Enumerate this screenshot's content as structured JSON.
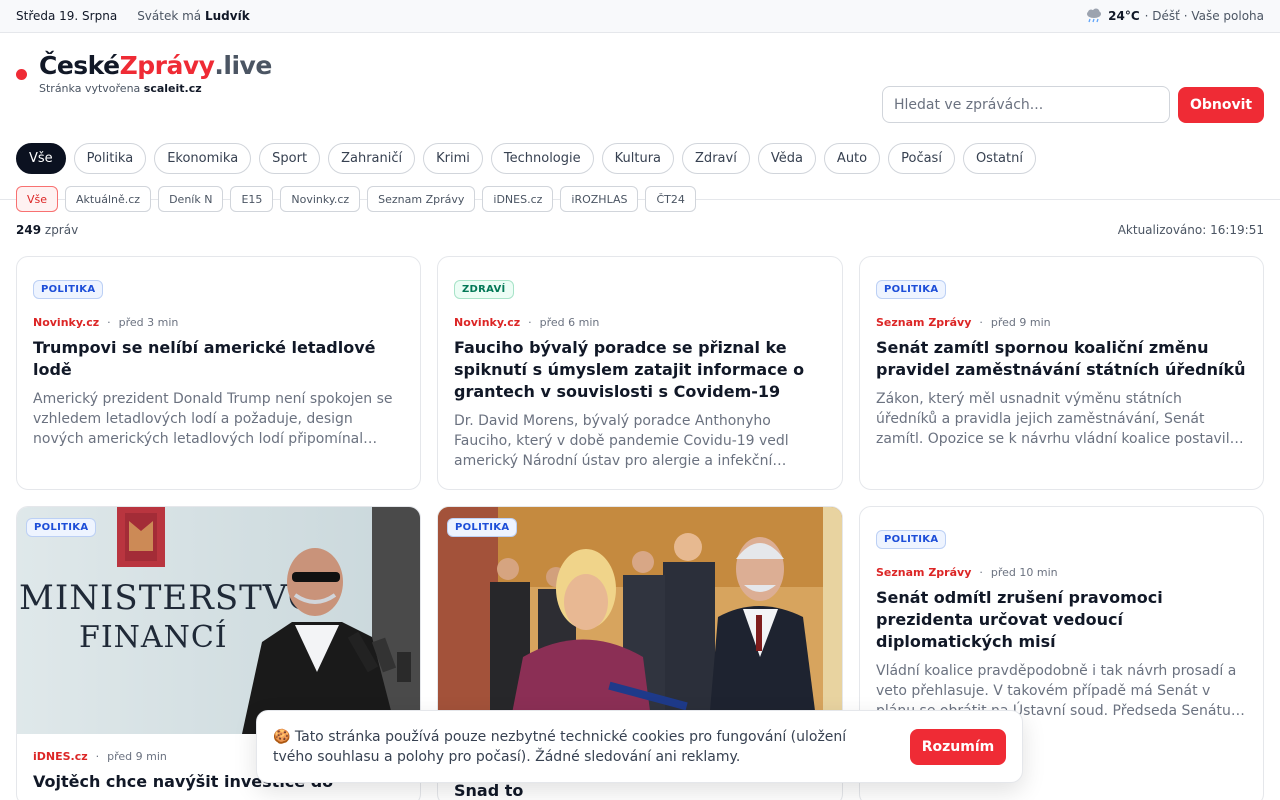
{
  "topbar": {
    "date": "Středa 19. Srpna",
    "nameday_prefix": "Svátek má",
    "nameday_name": "Ludvík",
    "weather_icon": "rain-cloud-icon",
    "temperature": "24°C",
    "weather_text": "· Déšť · Vaše poloha"
  },
  "brand": {
    "logo_part1": "České",
    "logo_part2": "Zprávy",
    "logo_part3": ".live",
    "sub_prefix": "Stránka vytvořena",
    "sub_link": "scaleit.cz"
  },
  "search": {
    "placeholder": "Hledat ve zprávách..."
  },
  "refresh_label": "Obnovit",
  "categories": [
    "Vše",
    "Politika",
    "Ekonomika",
    "Sport",
    "Zahraničí",
    "Krimi",
    "Technologie",
    "Kultura",
    "Zdraví",
    "Věda",
    "Auto",
    "Počasí",
    "Ostatní"
  ],
  "sources": [
    "Vše",
    "Aktuálně.cz",
    "Deník N",
    "E15",
    "Novinky.cz",
    "Seznam Zprávy",
    "iDNES.cz",
    "iROZHLAS",
    "ČT24"
  ],
  "info": {
    "count": "249",
    "count_label": "zpráv",
    "updated": "Aktualizováno: 16:19:51"
  },
  "articles": [
    {
      "tag": "POLITIKA",
      "source": "Novinky.cz",
      "time": "před 3 min",
      "title": "Trumpovi se nelíbí americké letadlové lodě",
      "desc": "Americký prezident Donald Trump není spokojen se vzhledem letadlových lodí a požaduje, design nových amerických letadlových lodí připomínal plavidla z druhé světové války."
    },
    {
      "tag": "ZDRAVÍ",
      "source": "Novinky.cz",
      "time": "před 6 min",
      "title": "Fauciho bývalý poradce se přiznal ke spiknutí s úmyslem zatajit informace o grantech v souvislosti s Covidem-19",
      "desc": "Dr. David Morens, bývalý poradce Anthonyho Fauciho, který v době pandemie Covidu-19 vedl americký Národní ústav pro alergie a infekční nemoci (NIAID), se přiznal."
    },
    {
      "tag": "POLITIKA",
      "source": "Seznam Zprávy",
      "time": "před 9 min",
      "title": "Senát zamítl spornou koaliční změnu pravidel zaměstnávání státních úředníků",
      "desc": "Zákon, který měl usnadnit výměnu státních úředníků a pravidla jejich zaměstnávání, Senát zamítl. Opozice se k návrhu vládní koalice postavila kriticky."
    },
    {
      "tag": "POLITIKA",
      "source": "iDNES.cz",
      "time": "před 9 min",
      "title": "Vojtěch chce navýšit investice do",
      "desc": "",
      "image_text_line1": "MINISTERSTVO",
      "image_text_line2": "FINANCÍ"
    },
    {
      "tag": "POLITIKA",
      "source": "",
      "time": "",
      "title": "Pavel řešil s Mrázovou stavební zákon. Snad to",
      "desc": ""
    },
    {
      "tag": "POLITIKA",
      "source": "Seznam Zprávy",
      "time": "před 10 min",
      "title": "Senát odmítl zrušení pravomoci prezidenta určovat vedoucí diplomatických misí",
      "desc": "Vládní koalice pravděpodobně i tak návrh prosadí a veto přehlasuje. V takovém případě má Senát v plánu se obrátit na Ústavní soud. Předseda Senátu Miloš Vystrčil uvedl, že…"
    }
  ],
  "cookie": {
    "text": "🍪 Tato stránka používá pouze nezbytné technické cookies pro fungování (uložení tvého souhlasu a polohy pro počasí). Žádné sledování ani reklamy.",
    "button": "Rozumím"
  },
  "colors": {
    "brand_red": "#ef2b35",
    "dark": "#0b1120",
    "politika_tag": "#1d4ed8",
    "zdravi_tag": "#047857"
  }
}
